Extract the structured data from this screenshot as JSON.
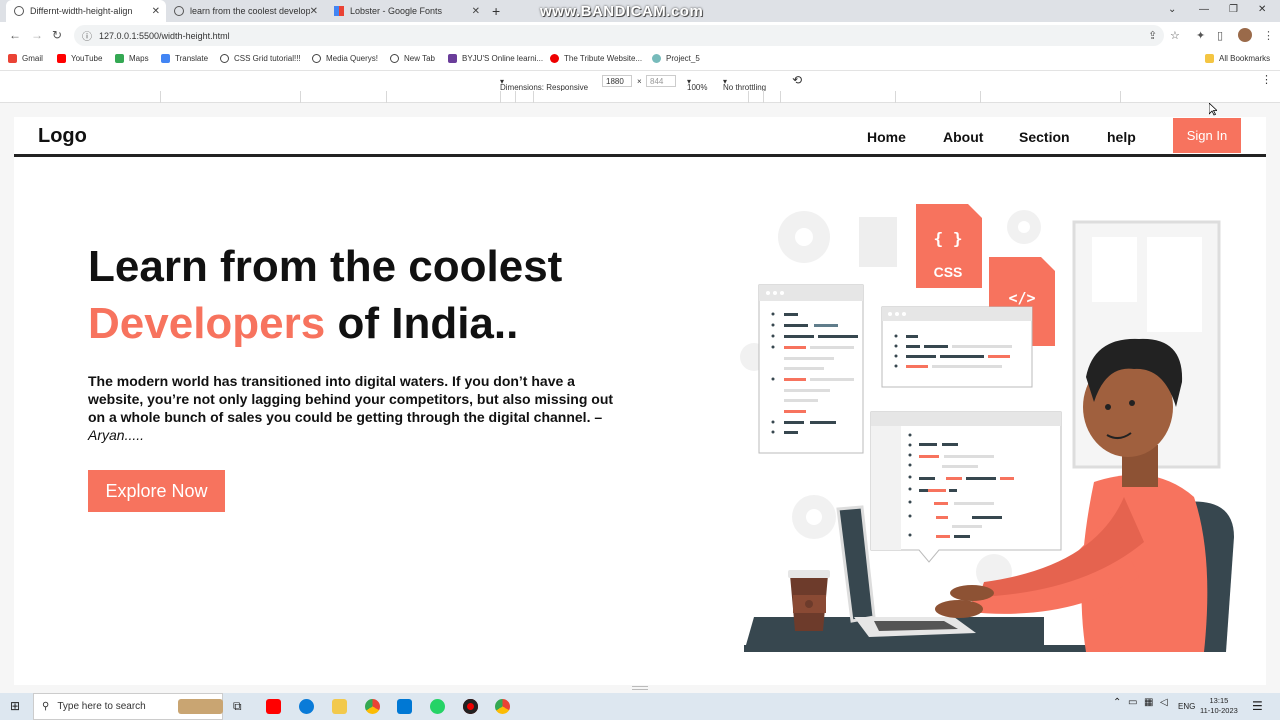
{
  "browser": {
    "tabs": [
      {
        "label": "Differnt-width-height-align",
        "active": true
      },
      {
        "label": "learn from the coolest develope",
        "active": false
      },
      {
        "label": "Lobster - Google Fonts",
        "active": false
      }
    ],
    "watermark": "www.BANDICAM.com",
    "url": "127.0.0.1:5500/width-height.html",
    "bookmarks": [
      "Gmail",
      "YouTube",
      "Maps",
      "Translate",
      "CSS Grid tutorial!!!",
      "Media Querys!",
      "New Tab",
      "BYJU'S Online learni...",
      "The Tribute Website...",
      "Project_5"
    ],
    "all_bookmarks": "All Bookmarks"
  },
  "devtools": {
    "dimensions": "Dimensions: Responsive",
    "width": "1880",
    "height": "844",
    "zoom": "100%",
    "throttling": "No throttling"
  },
  "site": {
    "logo": "Logo",
    "nav": [
      "Home",
      "About",
      "Section",
      "help"
    ],
    "signin": "Sign In",
    "title_line1": "Learn from the coolest",
    "title_accent": "Developers",
    "title_rest": " of India..",
    "body": "The modern world has transitioned into digital waters. If you don’t have a website, you’re not only lagging behind your competitors, but also missing out on a whole bunch of sales you could be getting through the digital channel. – ",
    "author": "Aryan.....",
    "cta": "Explore Now",
    "illustration": {
      "css_label": "CSS",
      "css_braces": "{ }",
      "html_label": "</>",
      "colors": {
        "accent": "#f7735e",
        "dark": "#37474f"
      }
    }
  },
  "taskbar": {
    "search_placeholder": "Type here to search",
    "lang": "ENG",
    "time": "13:15",
    "date": "11-10-2023"
  },
  "colors": {
    "accent": "#f7735e",
    "text": "#111111"
  }
}
